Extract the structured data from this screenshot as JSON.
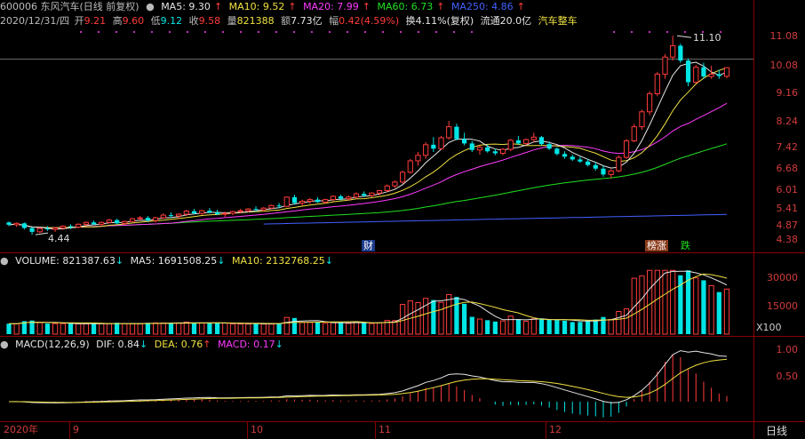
{
  "header": {
    "code_name": "600006 东风汽车(日线 前复权)",
    "ma5_label": "MA5: 9.30",
    "ma10_label": "MA10: 9.52",
    "ma20_label": "MA20: 7.99",
    "ma60_label": "MA60: 6.73",
    "ma250_label": "MA250: 4.86",
    "arrow": "↑"
  },
  "info": {
    "date": "2020/12/31/四",
    "open_k": "开",
    "open_v": "9.21",
    "high_k": "高",
    "high_v": "9.60",
    "low_k": "低",
    "low_v": "9.12",
    "close_k": "收",
    "close_v": "9.58",
    "vol_k": "量",
    "vol_v": "821388",
    "amt_k": "额",
    "amt_v": "7.73亿",
    "chg_k": "幅",
    "chg_v": "0.42(4.59%)",
    "turn": "换4.11%(复权)",
    "float": "流通20.0亿",
    "sector": "汽车整车"
  },
  "price_axis": [
    "11.08",
    "10.08",
    "9.16",
    "8.24",
    "7.42",
    "6.68",
    "6.01",
    "5.41",
    "4.87",
    "4.38"
  ],
  "price_annotations": {
    "high": "11.10",
    "low": "4.44"
  },
  "event_tags": {
    "finance": "财",
    "limit": "榜涨",
    "fall": "跌"
  },
  "volume_header": {
    "volume": "VOLUME: 821387.63",
    "ma5": "MA5: 1691508.25",
    "ma10": "MA10: 2132768.25",
    "arrow_down": "↓"
  },
  "volume_axis": [
    "30000",
    "15000"
  ],
  "volume_unit": "X100",
  "macd_header": {
    "title": "MACD(12,26,9)",
    "dif": "DIF: 0.84",
    "dea": "DEA: 0.76",
    "macd": "MACD: 0.17",
    "arrow_down": "↓",
    "arrow_up": "↑"
  },
  "macd_axis": [
    "1.00",
    "0.50"
  ],
  "date_axis": [
    "2020年",
    "9",
    "10",
    "11",
    "12"
  ],
  "period_label": "日线",
  "colors": {
    "up": "#ff3b3b",
    "down": "#00e5e5",
    "ma5": "#e6e6e6",
    "ma10": "#f0e040",
    "ma20": "#ff3bff",
    "ma60": "#20e020",
    "ma250": "#4060ff",
    "grid": "#8b0000"
  },
  "chart_data": {
    "type": "candlestick",
    "price_range": [
      4.2,
      11.4
    ],
    "candles": [
      [
        4.7,
        4.72,
        4.62,
        4.65
      ],
      [
        4.65,
        4.7,
        4.6,
        4.68
      ],
      [
        4.68,
        4.7,
        4.55,
        4.58
      ],
      [
        4.58,
        4.6,
        4.44,
        4.5
      ],
      [
        4.5,
        4.6,
        4.48,
        4.57
      ],
      [
        4.57,
        4.62,
        4.52,
        4.55
      ],
      [
        4.55,
        4.6,
        4.5,
        4.58
      ],
      [
        4.58,
        4.64,
        4.54,
        4.62
      ],
      [
        4.62,
        4.66,
        4.56,
        4.6
      ],
      [
        4.6,
        4.68,
        4.58,
        4.66
      ],
      [
        4.66,
        4.72,
        4.62,
        4.7
      ],
      [
        4.7,
        4.74,
        4.64,
        4.66
      ],
      [
        4.66,
        4.72,
        4.62,
        4.7
      ],
      [
        4.7,
        4.78,
        4.68,
        4.75
      ],
      [
        4.75,
        4.78,
        4.66,
        4.68
      ],
      [
        4.68,
        4.74,
        4.64,
        4.72
      ],
      [
        4.72,
        4.8,
        4.7,
        4.78
      ],
      [
        4.78,
        4.84,
        4.74,
        4.8
      ],
      [
        4.8,
        4.84,
        4.72,
        4.74
      ],
      [
        4.74,
        4.82,
        4.7,
        4.8
      ],
      [
        4.8,
        4.9,
        4.78,
        4.86
      ],
      [
        4.86,
        4.92,
        4.8,
        4.84
      ],
      [
        4.84,
        4.9,
        4.78,
        4.88
      ],
      [
        4.88,
        4.98,
        4.84,
        4.95
      ],
      [
        4.95,
        5.0,
        4.88,
        4.9
      ],
      [
        4.9,
        4.98,
        4.86,
        4.96
      ],
      [
        4.96,
        5.02,
        4.9,
        4.92
      ],
      [
        4.92,
        4.98,
        4.86,
        4.88
      ],
      [
        4.88,
        4.94,
        4.82,
        4.9
      ],
      [
        4.9,
        4.96,
        4.86,
        4.94
      ],
      [
        4.94,
        5.0,
        4.9,
        4.96
      ],
      [
        4.96,
        5.02,
        4.92,
        5.0
      ],
      [
        5.0,
        5.06,
        4.94,
        4.98
      ],
      [
        4.98,
        5.04,
        4.94,
        5.02
      ],
      [
        5.02,
        5.1,
        5.0,
        5.08
      ],
      [
        5.08,
        5.14,
        5.02,
        5.06
      ],
      [
        5.06,
        5.3,
        5.04,
        5.28
      ],
      [
        5.28,
        5.34,
        5.1,
        5.14
      ],
      [
        5.14,
        5.22,
        5.08,
        5.18
      ],
      [
        5.18,
        5.26,
        5.12,
        5.22
      ],
      [
        5.22,
        5.28,
        5.14,
        5.16
      ],
      [
        5.16,
        5.24,
        5.12,
        5.22
      ],
      [
        5.22,
        5.32,
        5.18,
        5.3
      ],
      [
        5.3,
        5.34,
        5.2,
        5.24
      ],
      [
        5.24,
        5.32,
        5.2,
        5.28
      ],
      [
        5.28,
        5.4,
        5.24,
        5.36
      ],
      [
        5.36,
        5.42,
        5.28,
        5.32
      ],
      [
        5.32,
        5.4,
        5.28,
        5.38
      ],
      [
        5.38,
        5.46,
        5.32,
        5.44
      ],
      [
        5.44,
        5.6,
        5.4,
        5.56
      ],
      [
        5.56,
        5.7,
        5.5,
        5.66
      ],
      [
        5.66,
        5.96,
        5.62,
        5.92
      ],
      [
        5.92,
        6.3,
        5.88,
        6.24
      ],
      [
        6.24,
        6.5,
        6.1,
        6.4
      ],
      [
        6.4,
        6.8,
        6.3,
        6.72
      ],
      [
        6.72,
        6.96,
        6.5,
        6.6
      ],
      [
        6.6,
        7.0,
        6.56,
        6.94
      ],
      [
        6.94,
        7.5,
        6.88,
        7.3
      ],
      [
        7.3,
        7.4,
        6.86,
        6.9
      ],
      [
        6.9,
        7.1,
        6.7,
        6.76
      ],
      [
        6.76,
        6.84,
        6.5,
        6.56
      ],
      [
        6.56,
        6.7,
        6.42,
        6.64
      ],
      [
        6.64,
        6.72,
        6.48,
        6.52
      ],
      [
        6.52,
        6.6,
        6.4,
        6.46
      ],
      [
        6.46,
        6.62,
        6.4,
        6.58
      ],
      [
        6.58,
        6.9,
        6.52,
        6.86
      ],
      [
        6.86,
        7.0,
        6.72,
        6.76
      ],
      [
        6.76,
        6.92,
        6.7,
        6.88
      ],
      [
        6.88,
        7.1,
        6.8,
        6.96
      ],
      [
        6.96,
        7.0,
        6.7,
        6.74
      ],
      [
        6.74,
        6.82,
        6.56,
        6.6
      ],
      [
        6.6,
        6.64,
        6.4,
        6.44
      ],
      [
        6.44,
        6.52,
        6.3,
        6.36
      ],
      [
        6.36,
        6.42,
        6.24,
        6.28
      ],
      [
        6.28,
        6.36,
        6.18,
        6.22
      ],
      [
        6.22,
        6.3,
        6.08,
        6.12
      ],
      [
        6.12,
        6.2,
        5.96,
        6.02
      ],
      [
        6.02,
        6.1,
        5.8,
        5.86
      ],
      [
        5.86,
        6.0,
        5.76,
        5.96
      ],
      [
        5.96,
        6.4,
        5.92,
        6.34
      ],
      [
        6.34,
        6.9,
        6.3,
        6.84
      ],
      [
        6.84,
        7.4,
        6.8,
        7.3
      ],
      [
        7.3,
        7.9,
        7.2,
        7.82
      ],
      [
        7.82,
        8.6,
        7.7,
        8.5
      ],
      [
        8.5,
        9.4,
        8.4,
        9.3
      ],
      [
        9.3,
        10.2,
        9.1,
        10.06
      ],
      [
        10.06,
        11.1,
        9.9,
        10.6
      ],
      [
        10.6,
        10.7,
        9.8,
        9.9
      ],
      [
        9.9,
        10.0,
        8.8,
        8.96
      ],
      [
        8.96,
        9.7,
        8.9,
        9.6
      ],
      [
        9.6,
        9.8,
        9.1,
        9.2
      ],
      [
        9.2,
        9.66,
        9.1,
        9.3
      ],
      [
        9.3,
        9.48,
        9.1,
        9.22
      ],
      [
        9.21,
        9.6,
        9.12,
        9.58
      ]
    ],
    "ma_series": [
      {
        "name": "MA5",
        "values_hint": "short moving average"
      },
      {
        "name": "MA10"
      },
      {
        "name": "MA20"
      },
      {
        "name": "MA60"
      },
      {
        "name": "MA250"
      }
    ]
  }
}
